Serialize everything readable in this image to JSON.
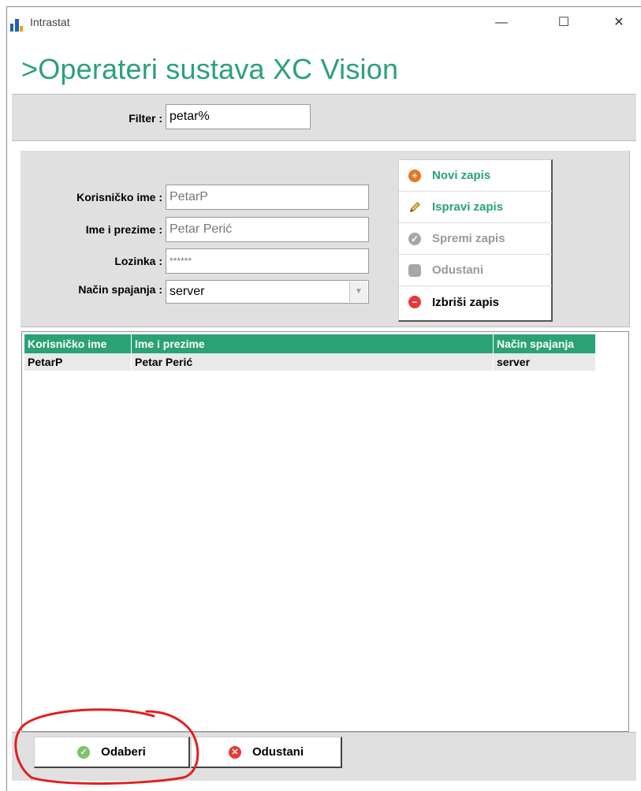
{
  "window": {
    "title": "Intrastat",
    "minimize_glyph": "—",
    "maximize_glyph": "☐",
    "close_glyph": "✕"
  },
  "heading": ">Operateri sustava XC Vision",
  "filter": {
    "label": "Filter :",
    "value": "petar%"
  },
  "form": {
    "username_label": "Korisničko ime :",
    "username_value": "PetarP",
    "fullname_label": "Ime i prezime :",
    "fullname_value": "Petar Perić",
    "password_label": "Lozinka :",
    "password_value": "******",
    "connection_label": "Način spajanja :",
    "connection_value": "server"
  },
  "actions": [
    {
      "label": "Novi zapis",
      "icon": "plus-circle-icon",
      "state": "enabled-green"
    },
    {
      "label": "Ispravi zapis",
      "icon": "pencil-icon",
      "state": "enabled-green"
    },
    {
      "label": "Spremi zapis",
      "icon": "check-circle-icon",
      "state": "disabled"
    },
    {
      "label": "Odustani",
      "icon": "octagon-icon",
      "state": "disabled"
    },
    {
      "label": "Izbriši zapis",
      "icon": "minus-circle-icon",
      "state": "enabled-black"
    }
  ],
  "table": {
    "columns": [
      "Korisničko ime",
      "Ime i prezime",
      "Način spajanja"
    ],
    "rows": [
      [
        "PetarP",
        "Petar Perić",
        "server"
      ]
    ]
  },
  "bottom": {
    "select_label": "Odaberi",
    "cancel_label": "Odustani"
  },
  "colors": {
    "accent": "#2aa276",
    "disabled": "#9a9a9a",
    "annotation": "#e02020"
  }
}
